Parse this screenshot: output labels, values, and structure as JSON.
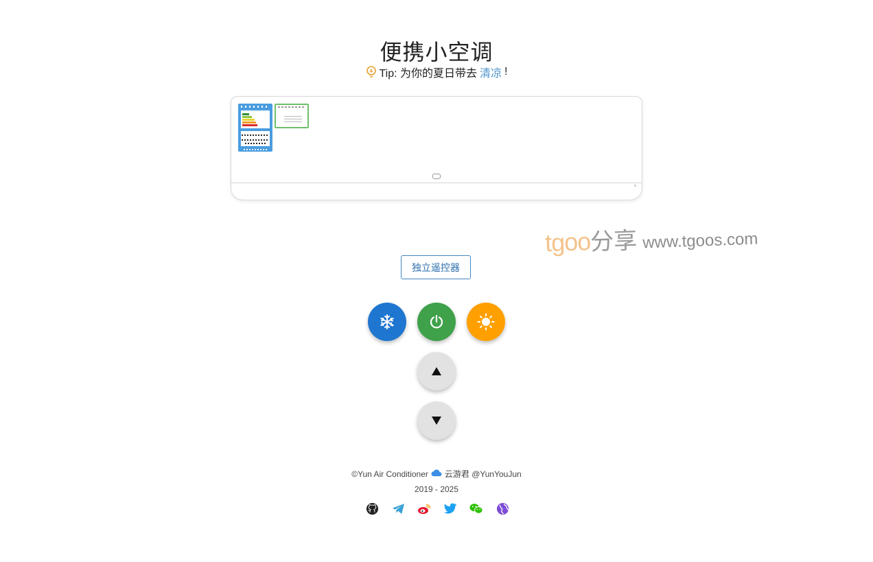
{
  "page": {
    "title": "便携小空调",
    "tip": {
      "prefix": "Tip: 为你的夏日带去",
      "highlight": "清凉",
      "suffix": "!"
    }
  },
  "air_conditioner": {
    "energy_label_icon": "energy-label",
    "eco_label_icon": "green-label"
  },
  "watermark": {
    "brand": "tgoo",
    "share": "分享",
    "site": "www.tgoos.com"
  },
  "remote": {
    "open_label": "独立遥控器"
  },
  "controls": {
    "cold_icon": "snowflake-icon",
    "power_icon": "power-icon",
    "hot_icon": "sun-icon",
    "up_icon": "arrow-up-icon",
    "down_icon": "arrow-down-icon",
    "cold_color": "#1e76d0",
    "power_color": "#3fa14a",
    "hot_color": "#ffa000"
  },
  "footer": {
    "copyright": "©Yun Air Conditioner",
    "author": "云游君 @YunYouJun",
    "years": "2019 - 2025",
    "social": [
      "github-icon",
      "telegram-icon",
      "weibo-icon",
      "twitter-icon",
      "wechat-icon",
      "website-icon"
    ]
  }
}
